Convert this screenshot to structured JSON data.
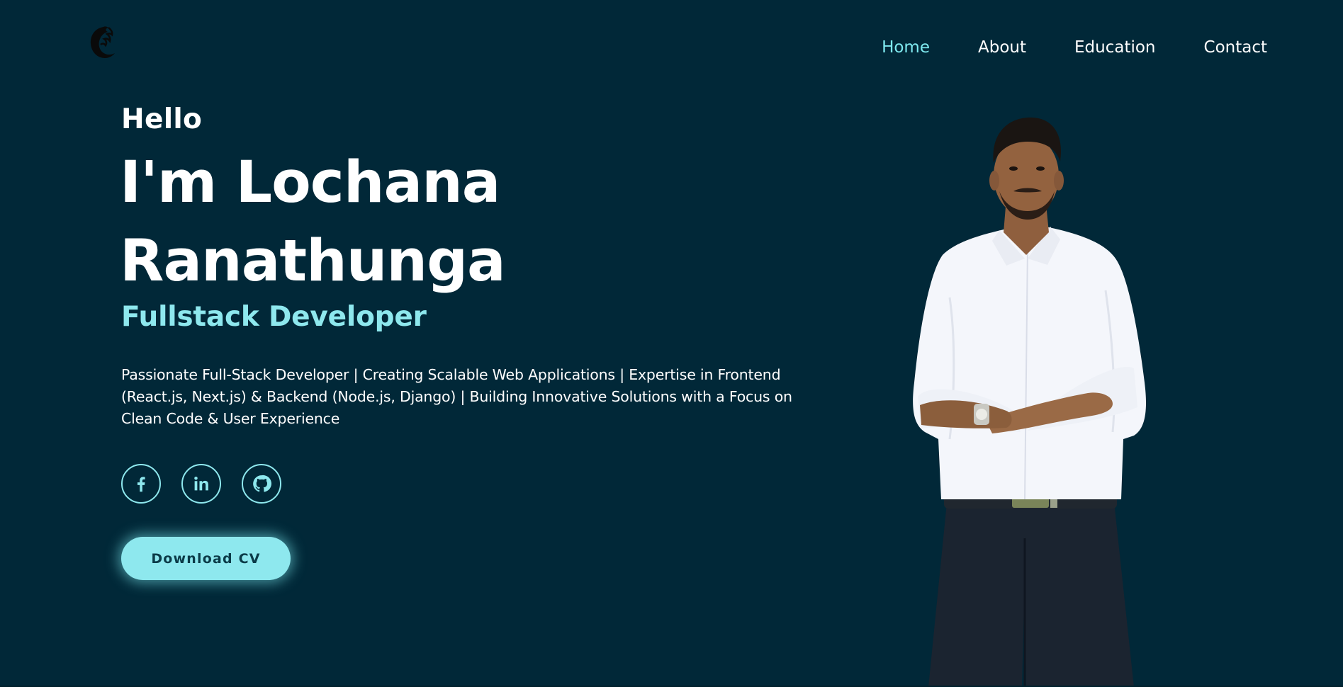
{
  "header": {
    "logo_icon": "dragon-crest-logo-icon",
    "nav": {
      "items": [
        "Home",
        "About",
        "Education",
        "Contact"
      ],
      "active": "Home"
    }
  },
  "hero": {
    "greeting": "Hello",
    "name_line1": "I'm Lochana",
    "name_line2": "Ranathunga",
    "role": "Fullstack Developer",
    "description": "Passionate Full-Stack Developer | Creating Scalable Web Applications | Expertise in Frontend (React.js, Next.js) & Backend (Node.js, Django) | Building Innovative Solutions with a Focus on Clean Code & User Experience",
    "socials": [
      {
        "icon": "facebook-icon"
      },
      {
        "icon": "linkedin-icon"
      },
      {
        "icon": "github-icon"
      }
    ],
    "cv_button_label": "Download CV"
  },
  "colors": {
    "background": "#012838",
    "accent": "#8ee8ee",
    "nav_active": "#7ee9ef",
    "text": "#ffffff",
    "button_text": "#0b3b48"
  }
}
